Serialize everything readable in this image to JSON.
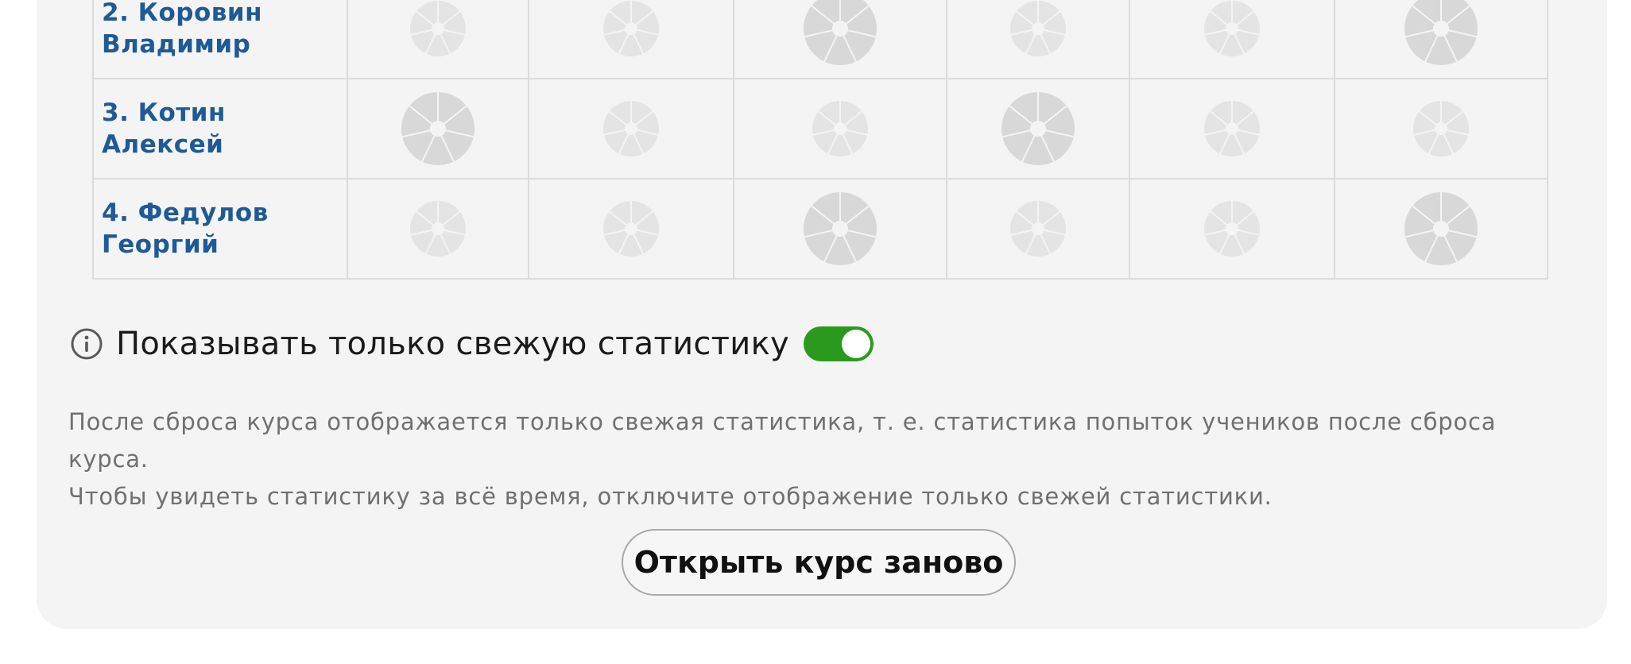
{
  "students": [
    {
      "name": "2. Коровин Владимир",
      "pies": [
        [
          "small",
          0.42
        ],
        [
          "small",
          0.42
        ],
        [
          "large",
          0.6
        ],
        [
          "small",
          0.38
        ],
        [
          "small",
          0.34
        ],
        [
          "large",
          0.52
        ]
      ]
    },
    {
      "name": "3. Котин Алексей",
      "pies": [
        [
          "large",
          0.4
        ],
        [
          "small",
          0.4
        ],
        [
          "small",
          0.3
        ],
        [
          "large",
          0.28
        ],
        [
          "small",
          0.32
        ],
        [
          "small",
          0.3
        ]
      ]
    },
    {
      "name": "4. Федулов Георгий",
      "pies": [
        [
          "small",
          0.42
        ],
        [
          "small",
          0.42
        ],
        [
          "large",
          0.6
        ],
        [
          "small",
          0.38
        ],
        [
          "small",
          0.34
        ],
        [
          "large",
          0.52
        ]
      ]
    }
  ],
  "fresh_stats": {
    "label": "Показывать только свежую статистику",
    "enabled": true,
    "note_line1": "После сброса курса отображается только свежая статистика, т. е. статистика попыток учеников после сброса курса.",
    "note_line2": "Чтобы увидеть статистику за всё время, отключите отображение только свежей статистики."
  },
  "reopen_button_label": "Открыть курс заново",
  "colors": {
    "link": "#1f5a96",
    "toggle_on": "#2a9a1e",
    "pie_large": "#d8d8d8",
    "pie_small": "#e4e4e4"
  }
}
